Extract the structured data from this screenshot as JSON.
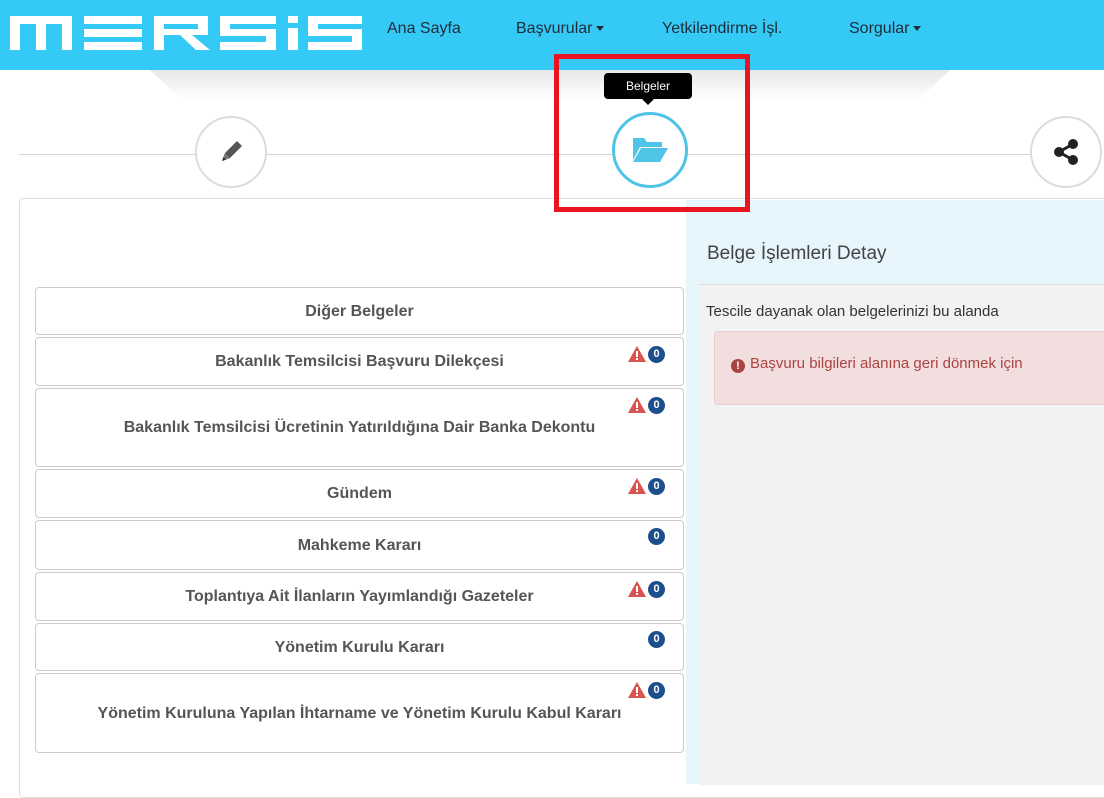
{
  "navbar": {
    "logo_text": "MERSiS",
    "items": [
      {
        "label": "Ana Sayfa",
        "dropdown": false
      },
      {
        "label": "Başvurular",
        "dropdown": true
      },
      {
        "label": "Yetkilendirme İşl.",
        "dropdown": false
      },
      {
        "label": "Sorgular",
        "dropdown": true
      }
    ]
  },
  "wizard": {
    "steps": [
      {
        "icon": "pencil-icon",
        "active": false
      },
      {
        "icon": "folder-open-icon",
        "active": true
      },
      {
        "icon": "share-icon",
        "active": false
      }
    ],
    "tooltip": "Belgeler"
  },
  "documents": [
    {
      "label": "Diğer Belgeler",
      "warning": false,
      "count": null
    },
    {
      "label": "Bakanlık Temsilcisi Başvuru Dilekçesi",
      "warning": true,
      "count": "0"
    },
    {
      "label": "Bakanlık Temsilcisi Ücretinin Yatırıldığına Dair Banka Dekontu",
      "warning": true,
      "count": "0"
    },
    {
      "label": "Gündem",
      "warning": true,
      "count": "0"
    },
    {
      "label": "Mahkeme Kararı",
      "warning": false,
      "count": "0"
    },
    {
      "label": "Toplantıya Ait İlanların Yayımlandığı Gazeteler",
      "warning": true,
      "count": "0"
    },
    {
      "label": "Yönetim Kurulu Kararı",
      "warning": false,
      "count": "0"
    },
    {
      "label": "Yönetim Kuruluna Yapılan İhtarname ve Yönetim Kurulu Kabul Kararı",
      "warning": true,
      "count": "0"
    }
  ],
  "detail": {
    "title": "Belge İşlemleri Detay",
    "description": "Tescile dayanak olan belgelerinizi bu alanda",
    "alert_icon": "!",
    "alert": "Başvuru bilgileri alanına geri dönmek için"
  },
  "colors": {
    "navbar": "#35c9f5",
    "highlight": "#e8141f",
    "active_step": "#4fc4e6",
    "warning": "#d9534f",
    "badge": "#1d4f8c",
    "alert_bg": "#f2dede",
    "alert_text": "#a94442"
  }
}
